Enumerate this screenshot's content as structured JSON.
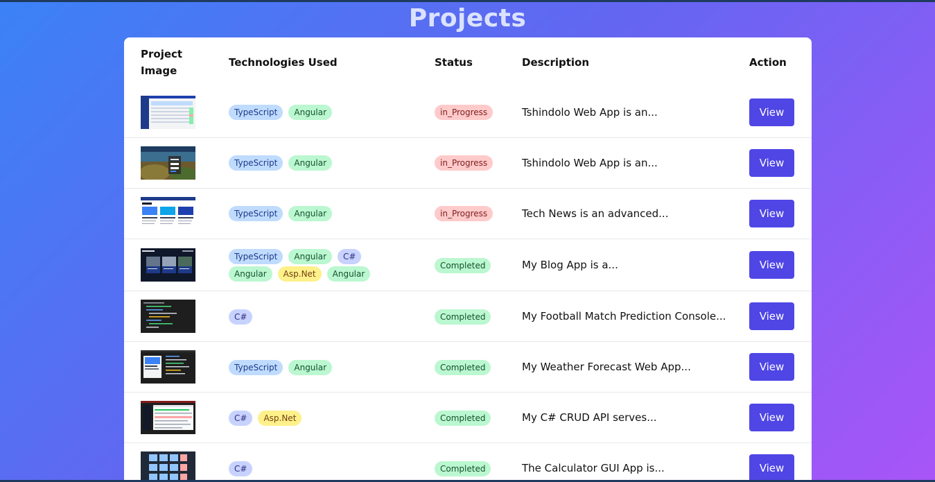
{
  "page": {
    "title": "Projects"
  },
  "table": {
    "headers": {
      "image": "Project Image",
      "technologies": "Technologies Used",
      "status": "Status",
      "description": "Description",
      "action": "Action"
    },
    "rows": [
      {
        "thumbnail": "dashboard-screenshot",
        "technologies": [
          "TypeScript",
          "Angular"
        ],
        "status": "in_Progress",
        "description": "Tshindolo Web App is an...",
        "action": "View"
      },
      {
        "thumbnail": "login-screenshot",
        "technologies": [
          "TypeScript",
          "Angular"
        ],
        "status": "in_Progress",
        "description": "Tshindolo Web App is an...",
        "action": "View"
      },
      {
        "thumbnail": "news-screenshot",
        "technologies": [
          "TypeScript",
          "Angular"
        ],
        "status": "in_Progress",
        "description": "Tech News is an advanced...",
        "action": "View"
      },
      {
        "thumbnail": "blog-screenshot",
        "technologies": [
          "TypeScript",
          "Angular",
          "C#",
          "Angular",
          "Asp.Net",
          "Angular"
        ],
        "status": "Completed",
        "description": "My Blog App is a...",
        "action": "View"
      },
      {
        "thumbnail": "console-screenshot",
        "technologies": [
          "C#"
        ],
        "status": "Completed",
        "description": "My Football Match Prediction Console...",
        "action": "View"
      },
      {
        "thumbnail": "weather-screenshot",
        "technologies": [
          "TypeScript",
          "Angular"
        ],
        "status": "Completed",
        "description": "My Weather Forecast Web App...",
        "action": "View"
      },
      {
        "thumbnail": "crud-api-screenshot",
        "technologies": [
          "C#",
          "Asp.Net"
        ],
        "status": "Completed",
        "description": "My C# CRUD API serves...",
        "action": "View"
      },
      {
        "thumbnail": "calculator-screenshot",
        "technologies": [
          "C#"
        ],
        "status": "Completed",
        "description": "The Calculator GUI App is...",
        "action": "View"
      }
    ]
  },
  "colors": {
    "accent": "#4f46e5",
    "in_progress_bg": "#fecaca",
    "completed_bg": "#bbf7d0",
    "typescript_bg": "#bfdbfe",
    "angular_bg": "#bbf7d0",
    "csharp_bg": "#c7d2fe",
    "aspnet_bg": "#fef08a"
  }
}
